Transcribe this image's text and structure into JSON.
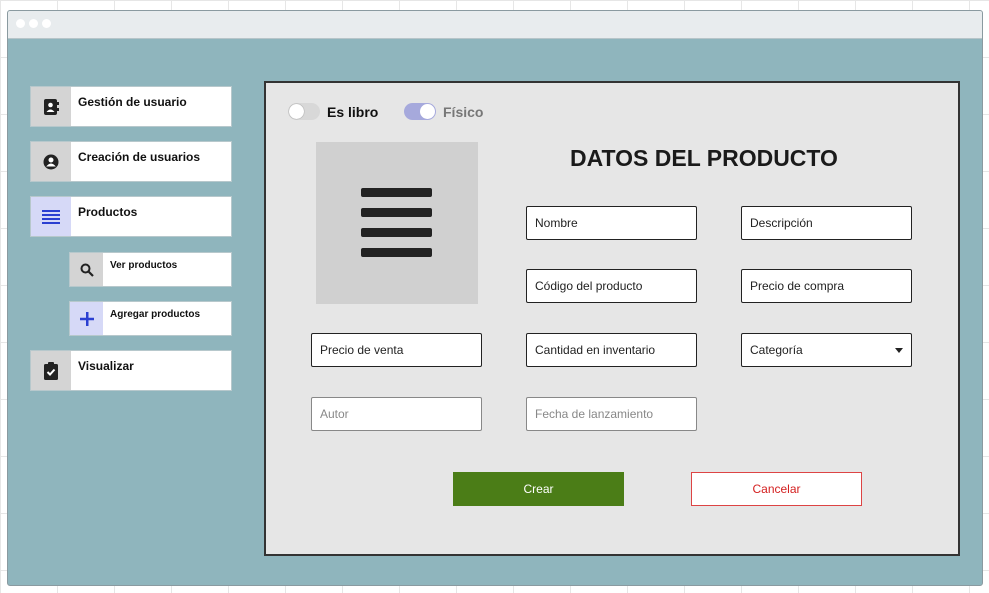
{
  "sidebar": {
    "items": [
      {
        "label": "Gestión de usuario",
        "icon": "contact-book-icon"
      },
      {
        "label": "Creación de usuarios",
        "icon": "user-circle-icon"
      },
      {
        "label": "Productos",
        "icon": "list-icon"
      },
      {
        "label": "Visualizar",
        "icon": "clipboard-check-icon"
      }
    ],
    "subitems": [
      {
        "label": "Ver productos",
        "icon": "search-icon"
      },
      {
        "label": "Agregar productos",
        "icon": "plus-icon"
      }
    ]
  },
  "form": {
    "toggles": [
      {
        "label": "Es libro",
        "state": "off"
      },
      {
        "label": "Físico",
        "state": "on"
      }
    ],
    "title": "DATOS DEL PRODUCTO",
    "fields": {
      "nombre": "Nombre",
      "descripcion": "Descripción",
      "codigo": "Código del producto",
      "precio_compra": "Precio de compra",
      "precio_venta": "Precio de venta",
      "cantidad": "Cantidad en inventario",
      "categoria": "Categoría",
      "autor": "Autor",
      "fecha": "Fecha de lanzamiento"
    },
    "buttons": {
      "create": "Crear",
      "cancel": "Cancelar"
    }
  },
  "colors": {
    "window_bg": "#8fb5bd",
    "create_button": "#4b7d17",
    "cancel_text": "#d42020",
    "active_toggle": "#a6a9dc",
    "active_nav": "#d6d9f7"
  }
}
